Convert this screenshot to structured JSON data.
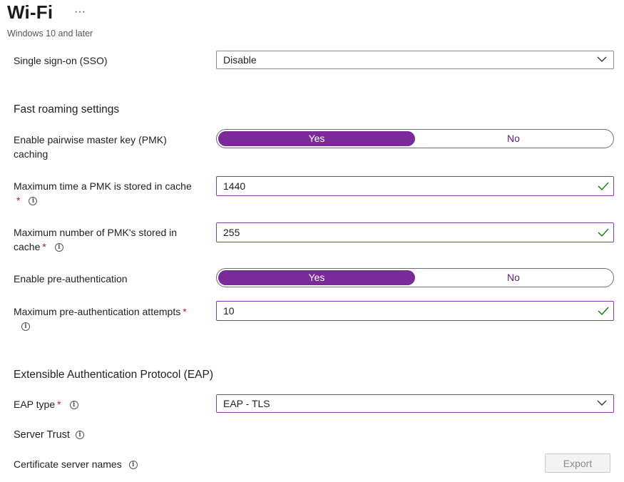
{
  "header": {
    "title": "Wi-Fi",
    "more": "···",
    "subtitle": "Windows 10 and later"
  },
  "sso": {
    "label": "Single sign-on (SSO)",
    "value": "Disable"
  },
  "fast_roaming": {
    "heading": "Fast roaming settings",
    "pmk_caching": {
      "label_line1": "Enable pairwise master key (PMK)",
      "label_line2": "caching",
      "yes": "Yes",
      "no": "No",
      "selected": "Yes"
    },
    "pmk_time": {
      "label": "Maximum time a PMK is stored in cache",
      "required": "*",
      "value": "1440"
    },
    "pmk_count": {
      "label_line1": "Maximum number of PMK's stored in",
      "label_line2": "cache",
      "required": "*",
      "value": "255"
    },
    "pre_auth": {
      "label": "Enable pre-authentication",
      "yes": "Yes",
      "no": "No",
      "selected": "Yes"
    },
    "pre_auth_attempts": {
      "label": "Maximum pre-authentication attempts",
      "required": "*",
      "value": "10"
    }
  },
  "eap": {
    "heading": "Extensible Authentication Protocol (EAP)",
    "type": {
      "label": "EAP type",
      "required": "*",
      "value": "EAP - TLS"
    },
    "server_trust": {
      "label": "Server Trust"
    },
    "cert_names": {
      "label": "Certificate server names"
    },
    "export_label": "Export"
  },
  "colors": {
    "accent": "#7a2a99",
    "valid": "#107c10",
    "required": "#a4262c"
  }
}
